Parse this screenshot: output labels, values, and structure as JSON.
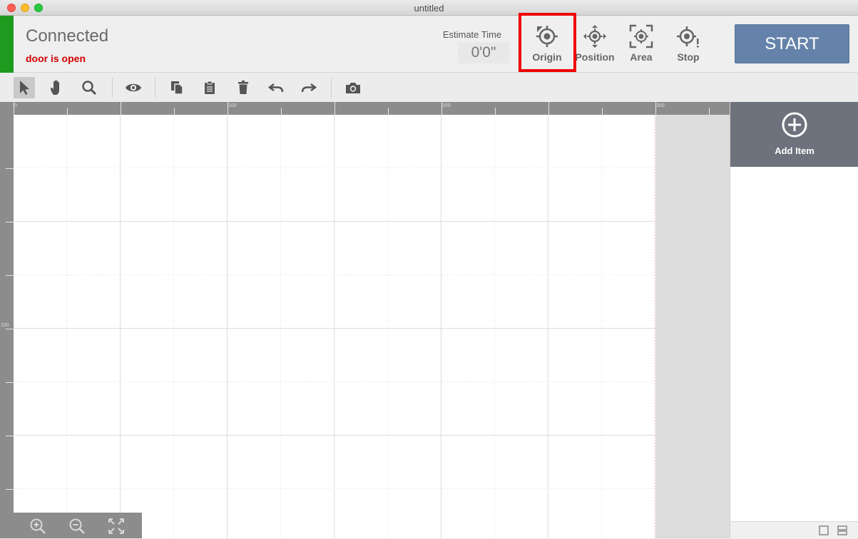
{
  "window": {
    "title": "untitled"
  },
  "header": {
    "connection_status": "Connected",
    "door_status": "door is open",
    "estimate_time_label": "Estimate Time",
    "estimate_time_value": "0'0\"",
    "tools": {
      "origin": "Origin",
      "position": "Position",
      "area": "Area",
      "stop": "Stop"
    },
    "start_label": "START"
  },
  "rulers": {
    "top": [
      "0",
      "100",
      "200",
      "300"
    ],
    "left": [
      "100"
    ]
  },
  "panel": {
    "add_item_label": "Add Item"
  },
  "colors": {
    "connected": "#1e9a1e",
    "door_warning": "#d40000",
    "start_button": "#6583aa",
    "highlight": "#f00000"
  }
}
